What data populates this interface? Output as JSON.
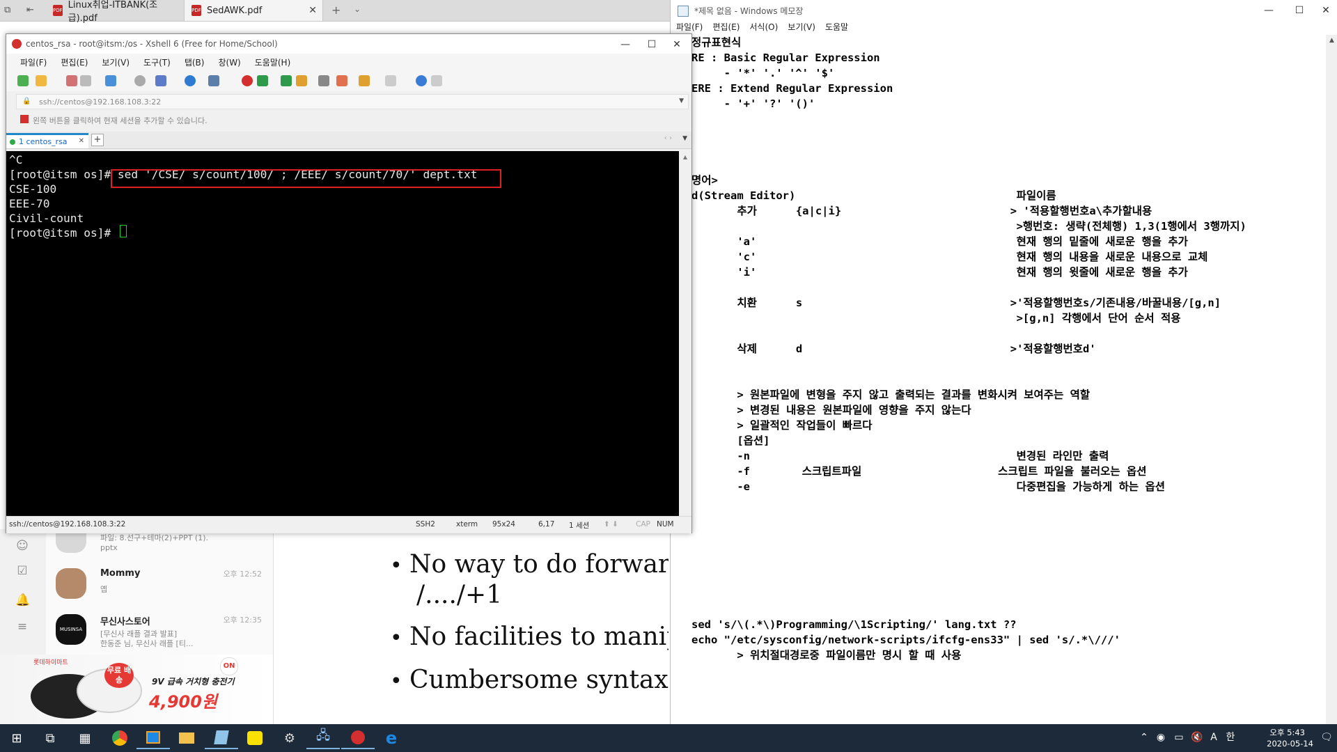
{
  "pdf_viewer": {
    "tabs": [
      {
        "label": "Linux취업-ITBANK(조급).pdf"
      },
      {
        "label": "SedAWK.pdf"
      }
    ],
    "bullets": [
      "No way to do forward",
      "/..../+1",
      "No facilities to manip",
      "Cumbersome syntax"
    ]
  },
  "messenger": {
    "items": [
      {
        "name": "",
        "preview1": "파일: 8.선구+테마(2)+PPT (1).",
        "preview2": "pptx",
        "time": ""
      },
      {
        "name": "Mommy",
        "preview1": "옙",
        "preview2": "",
        "time": "오후 12:52"
      },
      {
        "name": "무신사스토어",
        "preview1": "[무신사 래플 결과 발표]",
        "preview2": "한동준 님, 무신사 래플 [티...",
        "time": "오후 12:35",
        "avatar_text": "MUSINSA"
      }
    ],
    "ad": {
      "brand": "롯데하이마트",
      "badge": "무료 배송",
      "headline": "9V 급속 거치형 충전기",
      "price": "4,900원",
      "logo": "ON"
    }
  },
  "notepad": {
    "title": "*제목 없음 - Windows 메모장",
    "menu": [
      "파일(F)",
      "편집(E)",
      "서식(O)",
      "보기(V)",
      "도움말"
    ],
    "text": "정규표현식\nRE : Basic Regular Expression\n     - '*' '.' '^' '$'\nERE : Extend Regular Expression\n     - '+' '?' '()'\n\n\n\n\n명어>\nd(Stream Editor)                                  파일이름\n       추가      {a|c|i}                          > '적용할행번호a\\추가할내용\n                                                  >행번호: 생략(전체행) 1,3(1행에서 3행까지)\n       'a'                                        현재 행의 밑줄에 새로운 행을 추가\n       'c'                                        현재 행의 내용을 새로운 내용으로 교체\n       'i'                                        현재 행의 윗줄에 새로운 행을 추가\n\n       치환      s                                >'적용할행번호s/기존내용/바꿀내용/[g,n]\n                                                  >[g,n] 각행에서 단어 순서 적용\n\n       삭제      d                                >'적용할행번호d'\n\n\n       > 원본파일에 변형을 주지 않고 출력되는 결과를 변화시켜 보여주는 역할\n       > 변경된 내용은 원본파일에 영향을 주지 않는다\n       > 일괄적인 작업들이 빠르다\n       [옵션]\n       -n                                         변경된 라인만 출력\n       -f        스크립트파일                     스크립트 파일을 불러오는 옵션\n       -e                                         다중편집을 가능하게 하는 옵션\n\n\n\n\n\n\n\n\nsed 's/\\(.*\\)Programming/\\1Scripting/' lang.txt ??\necho \"/etc/sysconfig/network-scripts/ifcfg-ens33\" | sed 's/.*\\///'\n       > 위치절대경로중 파일이름만 명시 할 때 사용"
  },
  "xshell": {
    "title": "centos_rsa - root@itsm:/os - Xshell 6 (Free for Home/School)",
    "menu": [
      "파일(F)",
      "편집(E)",
      "보기(V)",
      "도구(T)",
      "탭(B)",
      "창(W)",
      "도움말(H)"
    ],
    "address": "ssh://centos@192.168.108.3:22",
    "hint": "왼쪽 버튼을 클릭하여 현재 세션을 추가할 수 있습니다.",
    "tab_label": "1 centos_rsa",
    "terminal_text": "^C\n[root@itsm os]# sed '/CSE/ s/count/100/ ; /EEE/ s/count/70/' dept.txt\nCSE-100\nEEE-70\nCivil-count\n[root@itsm os]# ",
    "status": {
      "address": "ssh://centos@192.168.108.3:22",
      "protocol": "SSH2",
      "term": "xterm",
      "size": "95x24",
      "pos": "6,17",
      "sessions": "1 세션",
      "caps": "CAP",
      "num": "NUM"
    }
  },
  "taskbar": {
    "clock_time": "오후 5:43",
    "clock_date": "2020-05-14",
    "ime": "A"
  }
}
